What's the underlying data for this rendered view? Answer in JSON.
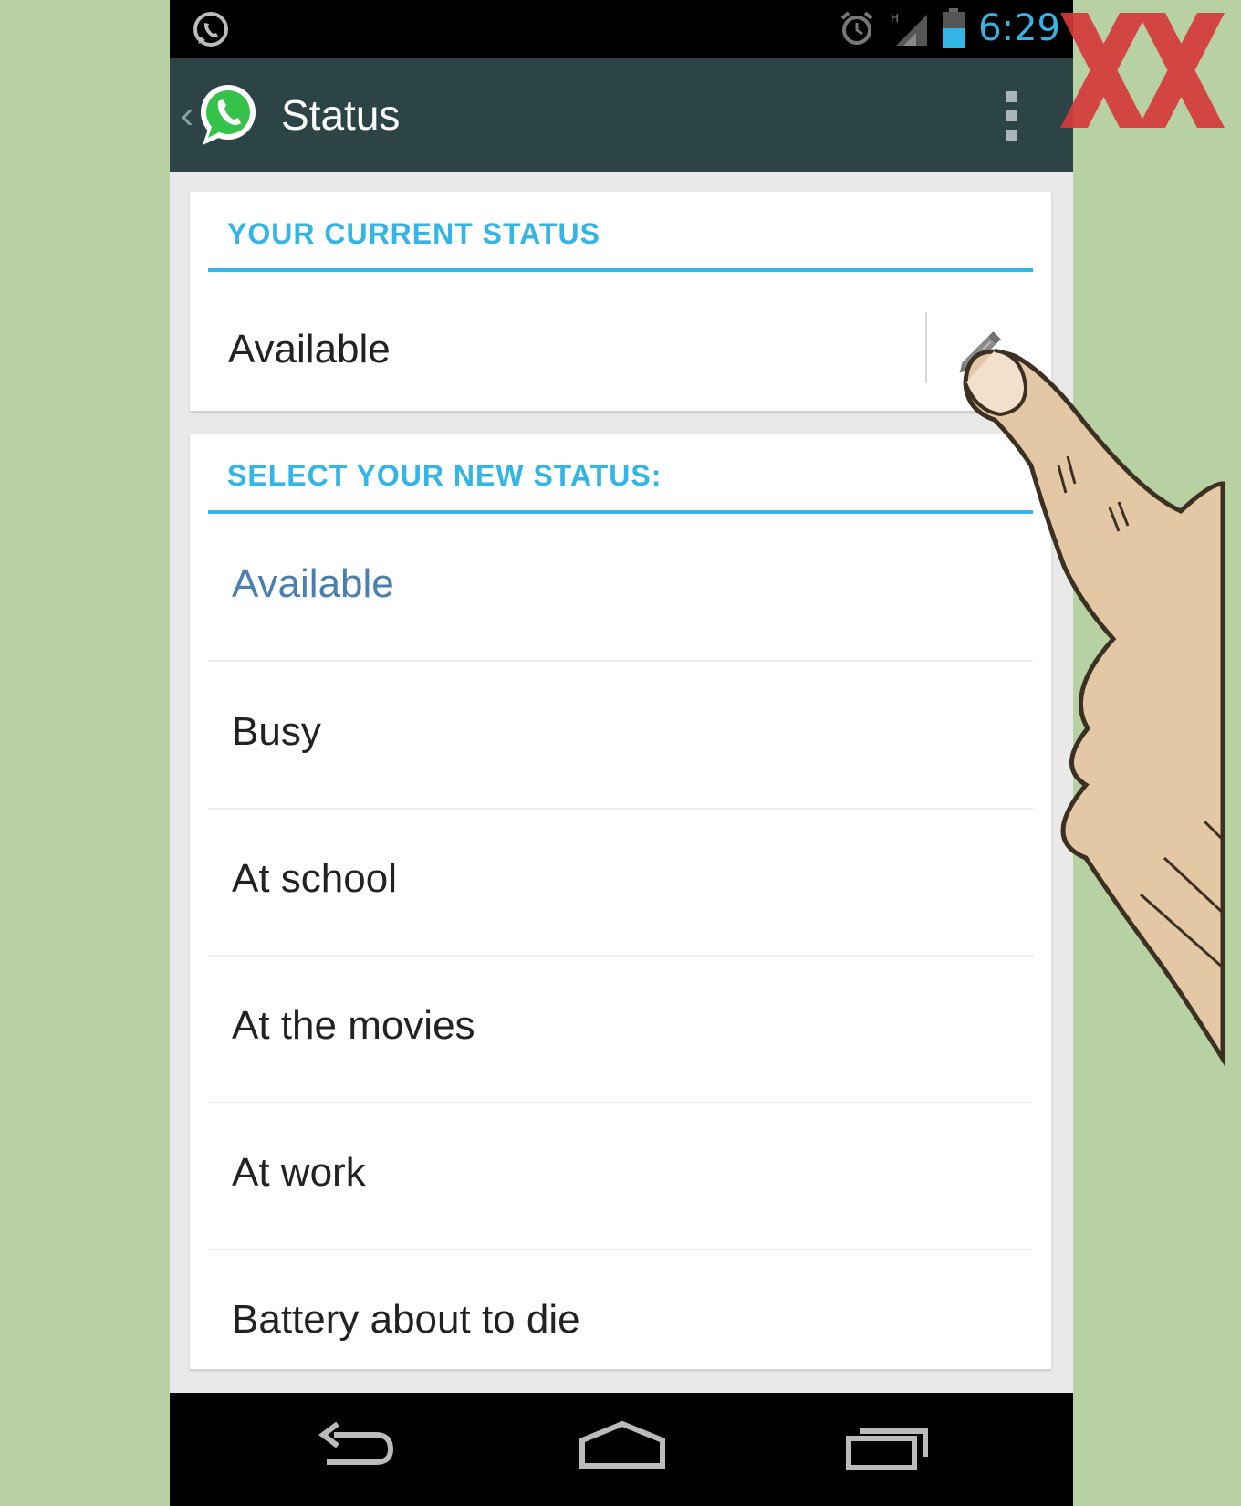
{
  "status_bar": {
    "time": "6:29",
    "icons": [
      "whatsapp-notification-icon",
      "alarm-icon",
      "signal-icon",
      "battery-icon"
    ]
  },
  "action_bar": {
    "title": "Status",
    "icons": [
      "back-icon",
      "whatsapp-logo",
      "overflow-menu-icon"
    ]
  },
  "current_status": {
    "header": "YOUR CURRENT STATUS",
    "value": "Available",
    "edit_icon": "pencil-icon"
  },
  "new_status": {
    "header": "SELECT YOUR NEW STATUS:",
    "options": [
      {
        "label": "Available",
        "selected": true
      },
      {
        "label": "Busy",
        "selected": false
      },
      {
        "label": "At school",
        "selected": false
      },
      {
        "label": "At the movies",
        "selected": false
      },
      {
        "label": "At work",
        "selected": false
      },
      {
        "label": "Battery about to die",
        "selected": false
      }
    ]
  },
  "nav_bar": {
    "icons": [
      "back-nav-icon",
      "home-nav-icon",
      "recents-nav-icon"
    ]
  },
  "colors": {
    "accent": "#33b5e5",
    "action_bar": "#2d4447",
    "selected_text": "#4a7fb0",
    "background": "#b8d1a2",
    "watermark": "#d63a3a"
  }
}
